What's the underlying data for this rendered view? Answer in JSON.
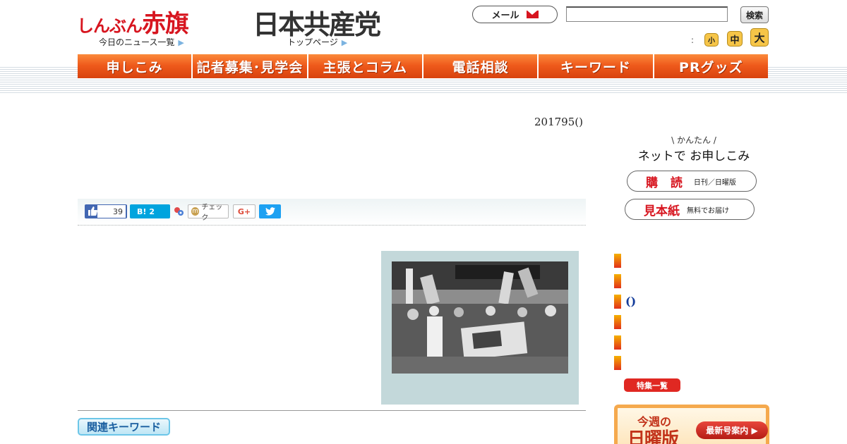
{
  "header": {
    "logo_small": "しんぶん",
    "logo_big": "赤旗",
    "jcp_logo": "日本共産党",
    "news_link": "今日のニュース一覧",
    "top_link": "トップページ",
    "mail_label": "メール",
    "search_placeholder": "",
    "search_button": "検索",
    "font_colon": ":",
    "font_small": "小",
    "font_medium": "中",
    "font_large": "大"
  },
  "nav": {
    "items": [
      "申しこみ",
      "記者募集･見学会",
      "主張とコラム",
      "電話相談",
      "キーワード",
      "PRグッズ"
    ]
  },
  "article": {
    "date": "201795()",
    "share": {
      "fb_count": "39",
      "hatena_label": "B!",
      "hatena_count": "2",
      "mixi_label": "チェック",
      "gplus_label": "G+"
    },
    "related_keywords": "関連キーワード"
  },
  "sidebar": {
    "kantan": "かんたん",
    "net_title": "ネットで お申しこみ",
    "subscribe": "購 読",
    "subscribe_note": "日刊／日曜版",
    "sample": "見本紙",
    "sample_note": "無料でお届け",
    "paren_text": "()",
    "tokushu": "特集一覧",
    "weekly": "今週の",
    "sunday_edition": "日曜版",
    "latest_issue": "最新号案内 ▶"
  },
  "colors": {
    "brand_red": "#d7151f",
    "nav_orange": "#ef5b1c",
    "sidebar_blue": "#123b9a"
  }
}
